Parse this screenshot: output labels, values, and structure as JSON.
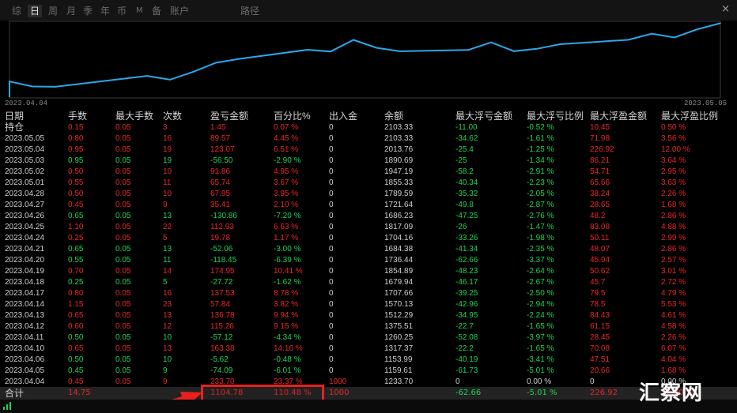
{
  "tabs": [
    {
      "label": "综",
      "active": false
    },
    {
      "label": "日",
      "active": true
    },
    {
      "label": "周",
      "active": false
    },
    {
      "label": "月",
      "active": false
    },
    {
      "label": "季",
      "active": false
    },
    {
      "label": "年",
      "active": false
    },
    {
      "label": "币",
      "active": false
    },
    {
      "label": "M",
      "active": false
    },
    {
      "label": "备",
      "active": false
    },
    {
      "label": "账户",
      "active": false
    },
    {
      "label": "路径",
      "active": false
    }
  ],
  "close_label": "×",
  "chart_data": {
    "type": "line",
    "x_start_label": "2023.04.04",
    "x_end_label": "2023.05.05",
    "line_color": "#2aa8e8",
    "series": [
      {
        "dates": [
          "2023.04.04",
          "2023.04.05",
          "2023.04.06",
          "2023.04.10",
          "2023.04.11",
          "2023.04.12",
          "2023.04.13",
          "2023.04.14",
          "2023.04.17",
          "2023.04.18",
          "2023.04.19",
          "2023.04.20",
          "2023.04.21",
          "2023.04.24",
          "2023.04.25",
          "2023.04.26",
          "2023.04.27",
          "2023.04.28",
          "2023.05.01",
          "2023.05.02",
          "2023.05.03",
          "2023.05.04",
          "2023.05.05"
        ],
        "values": [
          1233.7,
          1159.61,
          1153.99,
          1317.37,
          1260.25,
          1375.51,
          1512.29,
          1570.13,
          1707.66,
          1679.94,
          1854.89,
          1736.44,
          1684.38,
          1704.16,
          1817.09,
          1686.23,
          1721.64,
          1789.59,
          1855.33,
          1947.19,
          1890.69,
          2013.76,
          2103.33
        ]
      }
    ]
  },
  "table": {
    "headers": [
      "日期",
      "手数",
      "最大手数",
      "次数",
      "盈亏金额",
      "百分比%",
      "出入金",
      "余额",
      "最大浮亏金额",
      "最大浮亏比例",
      "最大浮盈金额",
      "最大浮盈比例"
    ],
    "rows": [
      {
        "date": "持仓",
        "sign": "pos",
        "lots": "0.15",
        "maxlots": "0.05",
        "count": "3",
        "pnl": "1.45",
        "pct": "0.07 %",
        "io": "0",
        "bal": "2103.33",
        "mfl": "-11.00",
        "mflp": "-0.52 %",
        "mfp": "10.45",
        "mfpp": "0.50 %"
      },
      {
        "date": "2023.05.05",
        "sign": "pos",
        "lots": "0.80",
        "maxlots": "0.05",
        "count": "16",
        "pnl": "89.57",
        "pct": "4.45 %",
        "io": "0",
        "bal": "2103.33",
        "mfl": "-34.62",
        "mflp": "-1.61 %",
        "mfp": "71.98",
        "mfpp": "3.56 %"
      },
      {
        "date": "2023.05.04",
        "sign": "pos",
        "lots": "0.95",
        "maxlots": "0.05",
        "count": "19",
        "pnl": "123.07",
        "pct": "6.51 %",
        "io": "0",
        "bal": "2013.76",
        "mfl": "-25.4",
        "mflp": "-1.25 %",
        "mfp": "226.92",
        "mfpp": "12.00 %"
      },
      {
        "date": "2023.05.03",
        "sign": "neg",
        "lots": "0.95",
        "maxlots": "0.05",
        "count": "19",
        "pnl": "-56.50",
        "pct": "-2.90 %",
        "io": "0",
        "bal": "1890.69",
        "mfl": "-25",
        "mflp": "-1.34 %",
        "mfp": "86.21",
        "mfpp": "3.64 %"
      },
      {
        "date": "2023.05.02",
        "sign": "pos",
        "lots": "0.50",
        "maxlots": "0.05",
        "count": "10",
        "pnl": "91.86",
        "pct": "4.95 %",
        "io": "0",
        "bal": "1947.19",
        "mfl": "-58.2",
        "mflp": "-2.91 %",
        "mfp": "54.71",
        "mfpp": "2.95 %"
      },
      {
        "date": "2023.05.01",
        "sign": "pos",
        "lots": "0.55",
        "maxlots": "0.05",
        "count": "11",
        "pnl": "65.74",
        "pct": "3.67 %",
        "io": "0",
        "bal": "1855.33",
        "mfl": "-40.34",
        "mflp": "-2.23 %",
        "mfp": "65.66",
        "mfpp": "3.63 %"
      },
      {
        "date": "2023.04.28",
        "sign": "pos",
        "lots": "0.50",
        "maxlots": "0.05",
        "count": "10",
        "pnl": "67.95",
        "pct": "3.95 %",
        "io": "0",
        "bal": "1789.59",
        "mfl": "-35.32",
        "mflp": "-2.05 %",
        "mfp": "38.24",
        "mfpp": "2.26 %"
      },
      {
        "date": "2023.04.27",
        "sign": "pos",
        "lots": "0.45",
        "maxlots": "0.05",
        "count": "9",
        "pnl": "35.41",
        "pct": "2.10 %",
        "io": "0",
        "bal": "1721.64",
        "mfl": "-49.8",
        "mflp": "-2.87 %",
        "mfp": "28.65",
        "mfpp": "1.68 %"
      },
      {
        "date": "2023.04.26",
        "sign": "neg",
        "lots": "0.65",
        "maxlots": "0.05",
        "count": "13",
        "pnl": "-130.86",
        "pct": "-7.20 %",
        "io": "0",
        "bal": "1686.23",
        "mfl": "-47.25",
        "mflp": "-2.76 %",
        "mfp": "48.2",
        "mfpp": "2.86 %"
      },
      {
        "date": "2023.04.25",
        "sign": "pos",
        "lots": "1.10",
        "maxlots": "0.05",
        "count": "22",
        "pnl": "112.93",
        "pct": "6.63 %",
        "io": "0",
        "bal": "1817.09",
        "mfl": "-26",
        "mflp": "-1.47 %",
        "mfp": "83.08",
        "mfpp": "4.88 %"
      },
      {
        "date": "2023.04.24",
        "sign": "pos",
        "lots": "0.25",
        "maxlots": "0.05",
        "count": "5",
        "pnl": "19.78",
        "pct": "1.17 %",
        "io": "0",
        "bal": "1704.16",
        "mfl": "-33.26",
        "mflp": "-1.98 %",
        "mfp": "50.11",
        "mfpp": "2.99 %"
      },
      {
        "date": "2023.04.21",
        "sign": "neg",
        "lots": "0.65",
        "maxlots": "0.05",
        "count": "13",
        "pnl": "-52.06",
        "pct": "-3.00 %",
        "io": "0",
        "bal": "1684.38",
        "mfl": "-41.34",
        "mflp": "-2.35 %",
        "mfp": "48.07",
        "mfpp": "2.86 %"
      },
      {
        "date": "2023.04.20",
        "sign": "neg",
        "lots": "0.55",
        "maxlots": "0.05",
        "count": "11",
        "pnl": "-118.45",
        "pct": "-6.39 %",
        "io": "0",
        "bal": "1736.44",
        "mfl": "-62.66",
        "mflp": "-3.37 %",
        "mfp": "45.94",
        "mfpp": "2.57 %"
      },
      {
        "date": "2023.04.19",
        "sign": "pos",
        "lots": "0.70",
        "maxlots": "0.05",
        "count": "14",
        "pnl": "174.95",
        "pct": "10.41 %",
        "io": "0",
        "bal": "1854.89",
        "mfl": "-48.23",
        "mflp": "-2.64 %",
        "mfp": "50.62",
        "mfpp": "3.01 %"
      },
      {
        "date": "2023.04.18",
        "sign": "neg",
        "lots": "0.25",
        "maxlots": "0.05",
        "count": "5",
        "pnl": "-27.72",
        "pct": "-1.62 %",
        "io": "0",
        "bal": "1679.94",
        "mfl": "-46.17",
        "mflp": "-2.67 %",
        "mfp": "45.7",
        "mfpp": "2.72 %"
      },
      {
        "date": "2023.04.17",
        "sign": "pos",
        "lots": "0.80",
        "maxlots": "0.05",
        "count": "16",
        "pnl": "137.53",
        "pct": "8.78 %",
        "io": "0",
        "bal": "1707.66",
        "mfl": "-39.25",
        "mflp": "-2.50 %",
        "mfp": "79.5",
        "mfpp": "4.79 %"
      },
      {
        "date": "2023.04.14",
        "sign": "pos",
        "lots": "1.15",
        "maxlots": "0.05",
        "count": "23",
        "pnl": "57.84",
        "pct": "3.82 %",
        "io": "0",
        "bal": "1570.13",
        "mfl": "-42.96",
        "mflp": "-2.94 %",
        "mfp": "78.5",
        "mfpp": "5.53 %"
      },
      {
        "date": "2023.04.13",
        "sign": "pos",
        "lots": "0.65",
        "maxlots": "0.05",
        "count": "13",
        "pnl": "136.78",
        "pct": "9.94 %",
        "io": "0",
        "bal": "1512.29",
        "mfl": "-34.95",
        "mflp": "-2.24 %",
        "mfp": "84.43",
        "mfpp": "4.61 %"
      },
      {
        "date": "2023.04.12",
        "sign": "pos",
        "lots": "0.60",
        "maxlots": "0.05",
        "count": "12",
        "pnl": "115.26",
        "pct": "9.15 %",
        "io": "0",
        "bal": "1375.51",
        "mfl": "-22.7",
        "mflp": "-1.65 %",
        "mfp": "61.15",
        "mfpp": "4.58 %"
      },
      {
        "date": "2023.04.11",
        "sign": "neg",
        "lots": "0.50",
        "maxlots": "0.05",
        "count": "10",
        "pnl": "-57.12",
        "pct": "-4.34 %",
        "io": "0",
        "bal": "1260.25",
        "mfl": "-52.08",
        "mflp": "-3.97 %",
        "mfp": "28.45",
        "mfpp": "2.26 %"
      },
      {
        "date": "2023.04.10",
        "sign": "pos",
        "lots": "0.65",
        "maxlots": "0.05",
        "count": "13",
        "pnl": "163.38",
        "pct": "14.16 %",
        "io": "0",
        "bal": "1317.37",
        "mfl": "-22.2",
        "mflp": "-1.65 %",
        "mfp": "70.08",
        "mfpp": "6.07 %"
      },
      {
        "date": "2023.04.06",
        "sign": "neg",
        "lots": "0.50",
        "maxlots": "0.05",
        "count": "10",
        "pnl": "-5.62",
        "pct": "-0.48 %",
        "io": "0",
        "bal": "1153.99",
        "mfl": "-40.19",
        "mflp": "-3.41 %",
        "mfp": "47.51",
        "mfpp": "4.04 %"
      },
      {
        "date": "2023.04.05",
        "sign": "neg",
        "lots": "0.45",
        "maxlots": "0.05",
        "count": "9",
        "pnl": "-74.09",
        "pct": "-6.01 %",
        "io": "0",
        "bal": "1159.61",
        "mfl": "-61.73",
        "mflp": "-5.01 %",
        "mfp": "20.66",
        "mfpp": "1.68 %"
      },
      {
        "date": "2023.04.04",
        "sign": "pos",
        "lots": "0.45",
        "maxlots": "0.05",
        "count": "9",
        "pnl": "233.70",
        "pct": "23.37 %",
        "io": "1000",
        "bal": "1233.70",
        "mfl": "0",
        "mflp": "0.00 %",
        "mfp": "0",
        "mfpp": "0.00 %"
      }
    ],
    "total": {
      "label": "合计",
      "lots": "14.75",
      "pnl": "1104.78",
      "pct": "110.48 %",
      "io": "1000",
      "mfl": "-62.66",
      "mflp": "-5.01 %",
      "mfp": "226.92",
      "mfpp": "12.00 %"
    }
  },
  "watermark": "汇察网",
  "colors": {
    "positive": "#e8262b",
    "negative": "#1fd255",
    "line": "#2aa8e8",
    "highlight": "#e82020"
  }
}
